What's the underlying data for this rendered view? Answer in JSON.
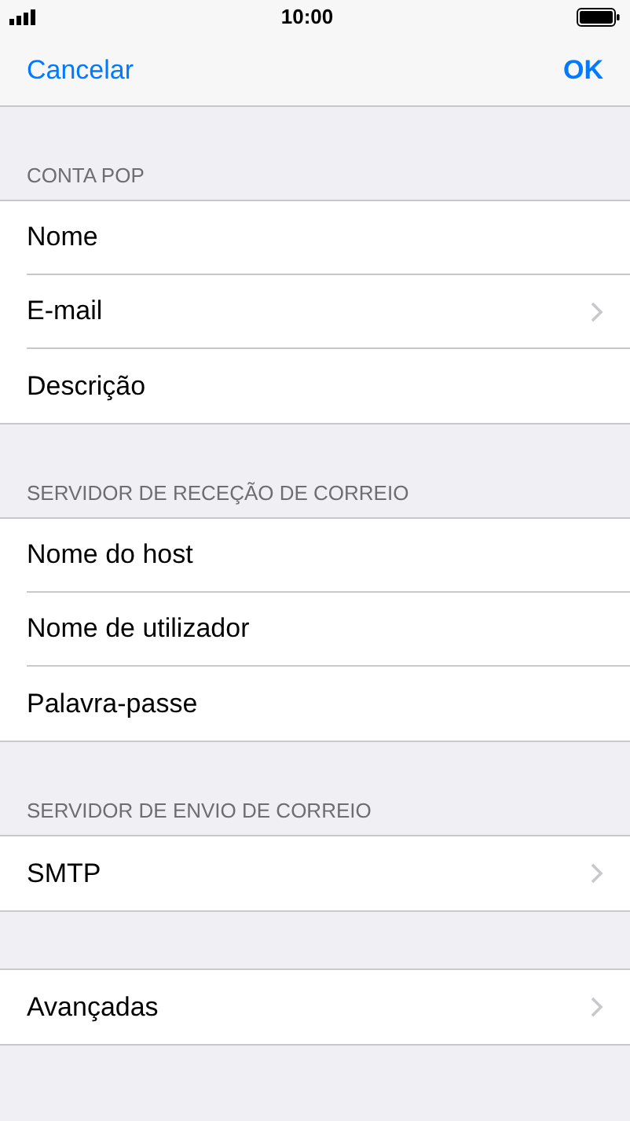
{
  "status_bar": {
    "time": "10:00"
  },
  "nav_bar": {
    "cancel": "Cancelar",
    "ok": "OK"
  },
  "sections": [
    {
      "header": "CONTA POP",
      "rows": [
        {
          "label": "Nome",
          "disclosure": false
        },
        {
          "label": "E-mail",
          "disclosure": true
        },
        {
          "label": "Descrição",
          "disclosure": false
        }
      ]
    },
    {
      "header": "SERVIDOR DE RECEÇÃO DE CORREIO",
      "rows": [
        {
          "label": "Nome do host",
          "disclosure": false
        },
        {
          "label": "Nome de utilizador",
          "disclosure": false
        },
        {
          "label": "Palavra-passe",
          "disclosure": false
        }
      ]
    },
    {
      "header": "SERVIDOR DE ENVIO DE CORREIO",
      "rows": [
        {
          "label": "SMTP",
          "disclosure": true
        }
      ]
    },
    {
      "rows": [
        {
          "label": "Avançadas",
          "disclosure": true
        }
      ]
    }
  ]
}
